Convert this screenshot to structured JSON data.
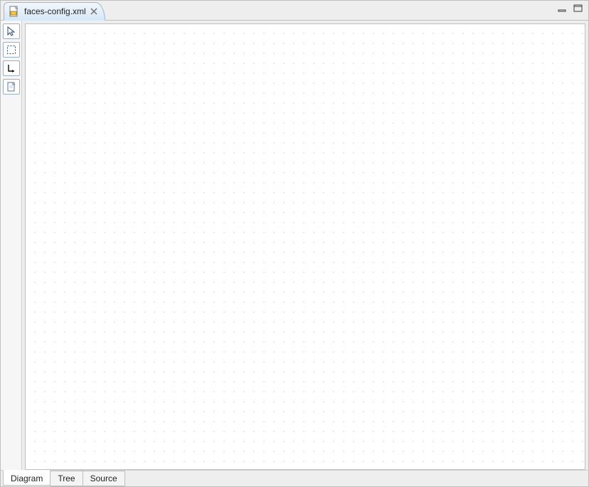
{
  "editor": {
    "file_tab": {
      "label": "faces-config.xml",
      "icon_name": "xml-file-icon",
      "close_name": "close-icon"
    },
    "window_controls": {
      "minimize_name": "minimize-icon",
      "maximize_name": "maximize-icon"
    }
  },
  "palette": {
    "tools": [
      {
        "name": "select-tool",
        "icon": "cursor-icon"
      },
      {
        "name": "marquee-tool",
        "icon": "marquee-icon"
      },
      {
        "name": "connection-tool",
        "icon": "connection-icon"
      },
      {
        "name": "new-page-tool",
        "icon": "new-page-icon"
      }
    ]
  },
  "bottom_tabs": [
    {
      "name": "view-tab-diagram",
      "label": "Diagram",
      "active": true
    },
    {
      "name": "view-tab-tree",
      "label": "Tree",
      "active": false
    },
    {
      "name": "view-tab-source",
      "label": "Source",
      "active": false
    }
  ]
}
